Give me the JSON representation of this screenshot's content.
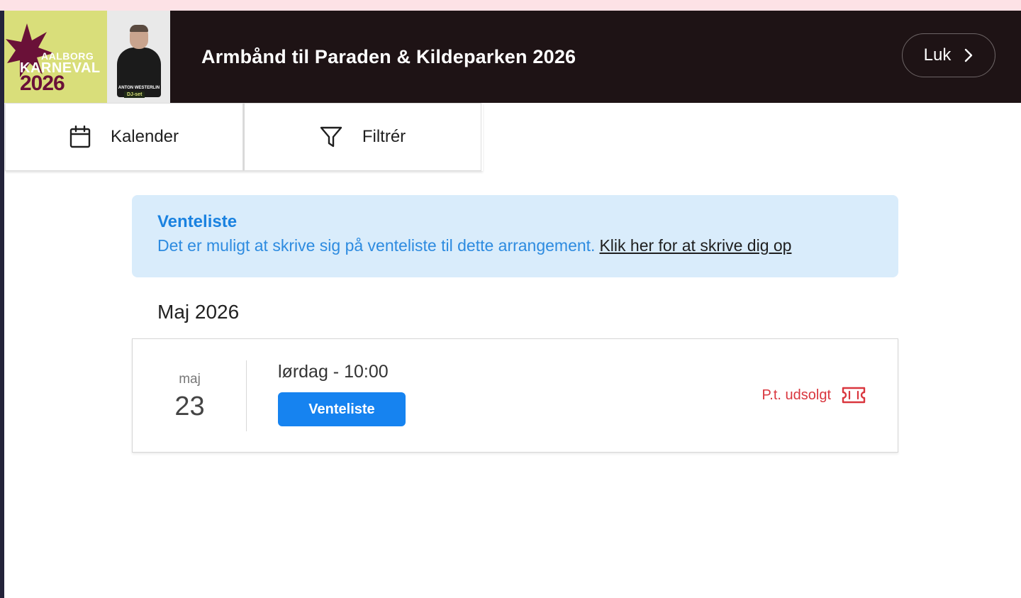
{
  "header": {
    "logo": {
      "line1": "AALBORG",
      "line2": "KARNEVAL",
      "year": "2026",
      "caption": "ANTON WESTERLIN",
      "tag": "DJ-set"
    },
    "title": "Armbånd til Paraden & Kildeparken 2026",
    "close_label": "Luk",
    "close_icon": "chevron-right-icon"
  },
  "toolbar": {
    "calendar_label": "Kalender",
    "calendar_icon": "calendar-icon",
    "filter_label": "Filtrér",
    "filter_icon": "filter-icon"
  },
  "waitlist_banner": {
    "title": "Venteliste",
    "text": "Det er muligt at skrive sig på venteliste til dette arrangement.",
    "link": "Klik her for at skrive dig op"
  },
  "month": "Maj 2026",
  "events": [
    {
      "month": "maj",
      "day": "23",
      "time": "lørdag - 10:00",
      "button_label": "Venteliste",
      "status": "P.t. udsolgt",
      "status_icon": "ticket-icon"
    }
  ],
  "colors": {
    "header_bg": "#1e1315",
    "banner_bg": "#d9ecfb",
    "accent_blue": "#1683f0",
    "status_red": "#d9363e",
    "logo_bg": "#d9de7a",
    "logo_star": "#6a1138"
  }
}
